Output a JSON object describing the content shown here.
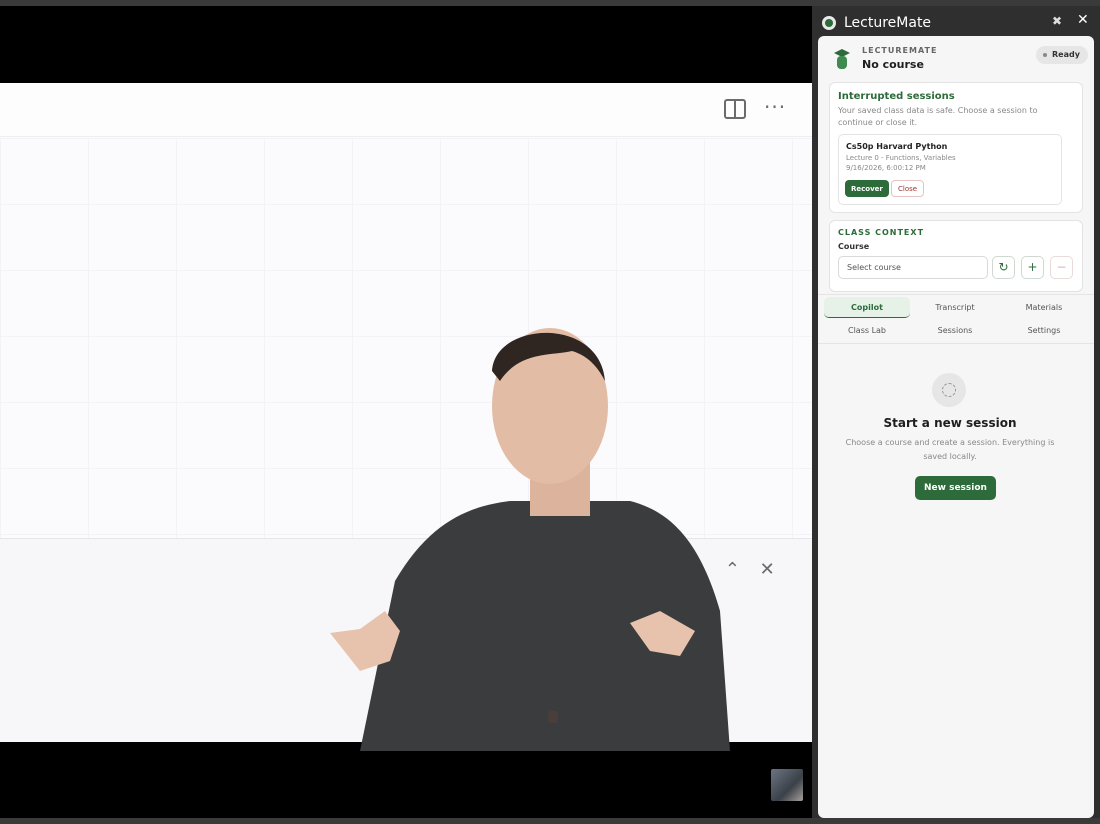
{
  "panel": {
    "title": "LectureMate",
    "brand": "LECTUREMATE",
    "course": "No course",
    "status": "Ready"
  },
  "interrupted": {
    "title": "Interrupted sessions",
    "subtitle": "Your saved class data is safe. Choose a session to continue or close it.",
    "session": {
      "name": "Cs50p Harvard Python",
      "lecture": "Lecture 0 - Functions, Variables",
      "time": "9/16/2026, 6:00:12 PM",
      "recover_label": "Recover",
      "close_label": "Close"
    }
  },
  "context": {
    "title": "CLASS CONTEXT",
    "course_label": "Course",
    "course_select": "Select course",
    "refresh_icon": "↻",
    "add_icon": "+",
    "remove_icon": "−"
  },
  "tabs": [
    "Copilot",
    "Transcript",
    "Materials",
    "Class Lab",
    "Sessions",
    "Settings"
  ],
  "empty_state": {
    "title": "Start a new session",
    "subtitle": "Choose a course and create a session. Everything is saved locally.",
    "button": "New session"
  },
  "video": {
    "more": "···",
    "find_down": "⌄",
    "find_up": "⌃",
    "find_close": "✕"
  },
  "icons": {
    "pin": "pin-icon",
    "close": "close-icon",
    "cap": "graduation-cap-icon"
  },
  "colors": {
    "accent": "#2d6b3b",
    "danger": "#9b3030"
  }
}
